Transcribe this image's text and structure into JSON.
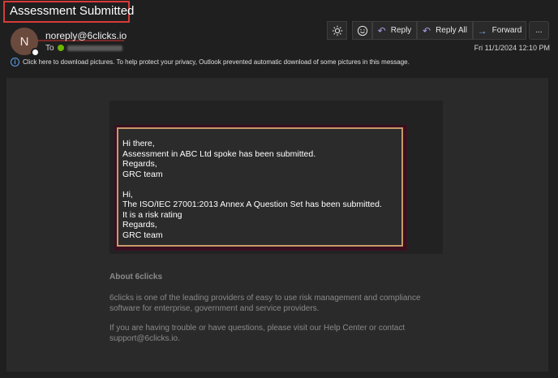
{
  "subject": "Assessment Submitted",
  "sender": {
    "initial": "N",
    "email": "noreply@6clicks.io",
    "to_label": "To"
  },
  "toolbar": {
    "sun_icon": "sun-icon",
    "emoji_icon": "emoji-icon",
    "reply_label": "Reply",
    "reply_all_label": "Reply All",
    "forward_label": "Forward",
    "more_label": "..."
  },
  "timestamp": "Fri 11/1/2024 12:10 PM",
  "info_bar": "Click here to download pictures. To help protect your privacy, Outlook prevented automatic download of some pictures in this message.",
  "body": {
    "lines_1": [
      "Hi there,",
      "Assessment in ABC Ltd spoke has been submitted.",
      "Regards,",
      "GRC team"
    ],
    "lines_2": [
      "Hi,",
      "The ISO/IEC 27001:2013 Annex A Question Set has been submitted.",
      "It is a risk rating",
      "Regards,",
      "GRC team"
    ]
  },
  "footer": {
    "about_title": "About 6clicks",
    "paragraph_1": "6clicks is one of the leading providers of easy to use risk management and compliance software for enterprise, government and service providers.",
    "paragraph_2": "If you are having trouble or have questions, please visit our Help Center or contact support@6clicks.io."
  },
  "colors": {
    "highlight_red": "#d63a3a",
    "card_border": "#c89a6a",
    "presence_green": "#6bb700",
    "accent_purple": "#a99ee6"
  }
}
